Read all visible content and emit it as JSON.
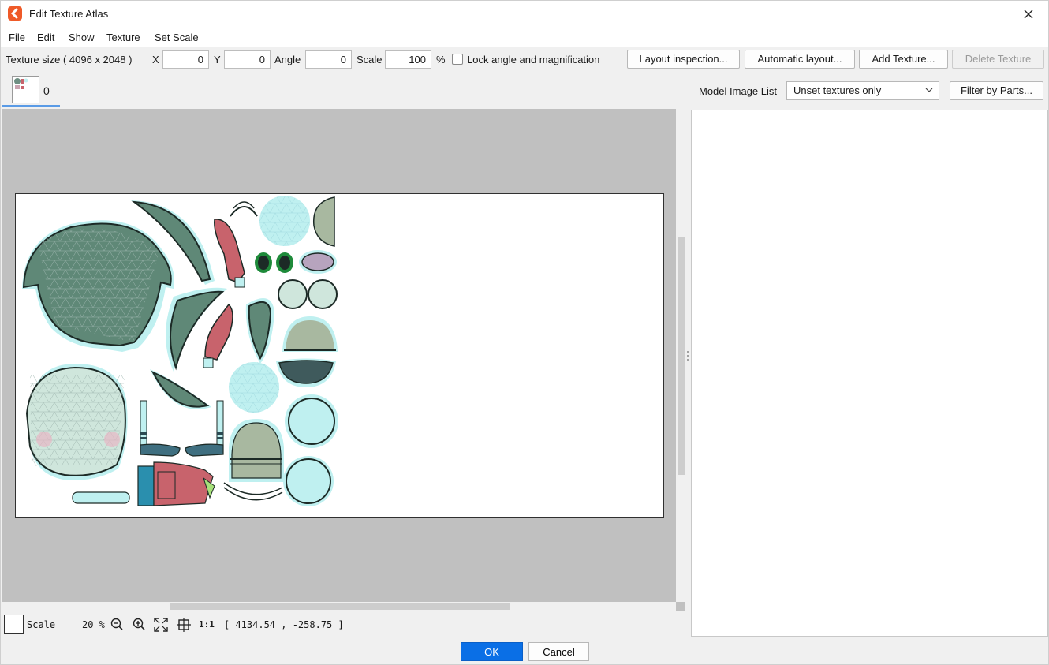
{
  "window": {
    "title": "Edit Texture Atlas"
  },
  "menu": [
    "File",
    "Edit",
    "Show",
    "Texture",
    "Set Scale"
  ],
  "toolbar": {
    "texture_size": "Texture size ( 4096 x 2048 )",
    "x_label": "X",
    "x_value": "0",
    "y_label": "Y",
    "y_value": "0",
    "angle_label": "Angle",
    "angle_value": "0",
    "scale_label": "Scale",
    "scale_value": "100",
    "percent": "%",
    "lock_label": "Lock angle and magnification",
    "lock_checked": false,
    "layout_inspection": "Layout inspection...",
    "automatic_layout": "Automatic layout...",
    "add_texture": "Add Texture...",
    "delete_texture": "Delete Texture"
  },
  "texture_tab": {
    "label": "0"
  },
  "model_image_list": {
    "label": "Model Image List",
    "filter_value": "Unset textures only",
    "filter_button": "Filter by Parts..."
  },
  "status": {
    "scale_label": "Scale",
    "zoom": "20 %",
    "actual_size": "1:1",
    "coords": "[ 4134.54 , -258.75 ]"
  },
  "footer": {
    "ok": "OK",
    "cancel": "Cancel"
  },
  "colors": {
    "accent": "#0a6fe6",
    "mesh_fill": "#bff0f0",
    "hair": "#5f8877",
    "skin": "#cfe6dc",
    "clothing_red": "#c8636c",
    "shorts_blue": "#2a8fae"
  }
}
